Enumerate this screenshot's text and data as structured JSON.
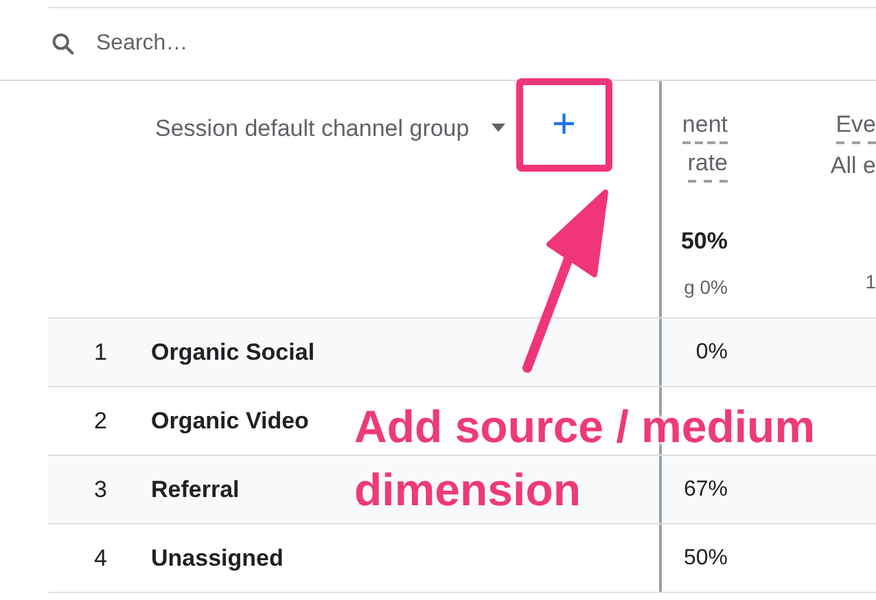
{
  "search": {
    "placeholder": "Search…"
  },
  "table": {
    "dimension_header": "Session default channel group",
    "add_button": "+",
    "columns": [
      {
        "title_lines": [
          "nent",
          "rate"
        ],
        "total": "50%",
        "subtotal": "g 0%"
      },
      {
        "title_lines": [
          "Eve"
        ],
        "subtitle": "All e",
        "subtotal": "1"
      }
    ],
    "rows": [
      {
        "index": "1",
        "name": "Organic Social",
        "value": "0%"
      },
      {
        "index": "2",
        "name": "Organic Video"
      },
      {
        "index": "3",
        "name": "Referral",
        "value": "67%"
      },
      {
        "index": "4",
        "name": "Unassigned",
        "value": "50%"
      }
    ]
  },
  "annotation": {
    "lines": [
      "Add source / medium",
      "dimension"
    ]
  }
}
